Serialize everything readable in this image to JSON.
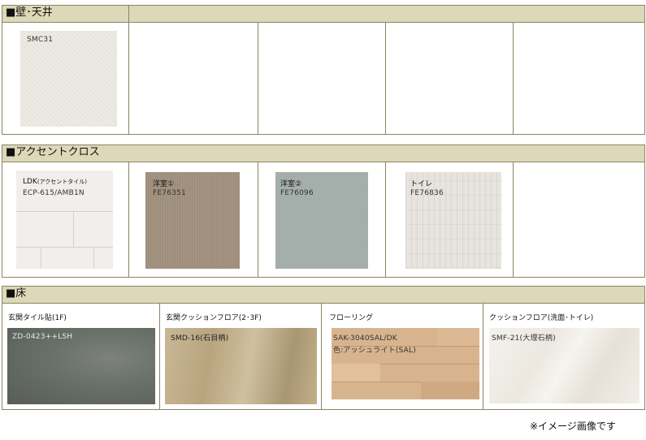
{
  "sections": {
    "wall": {
      "title": "■壁･天井",
      "items": [
        {
          "code": "SMC31"
        }
      ]
    },
    "accent": {
      "title": "■アクセントクロス",
      "items": [
        {
          "room": "LDK",
          "room_note": "(アクセントタイル)",
          "code": "ECP-615/AMB1N"
        },
        {
          "room": "洋室①",
          "code": "FE76351"
        },
        {
          "room": "洋室②",
          "code": "FE76096"
        },
        {
          "room": "トイレ",
          "code": "FE76836"
        }
      ]
    },
    "floor": {
      "title": "■床",
      "items": [
        {
          "label": "玄関タイル貼(1F)",
          "code": "ZD-0423++LSH"
        },
        {
          "label": "玄関クッションフロア(2･3F)",
          "code": "SMD-16(石目柄)"
        },
        {
          "label": "フローリング",
          "code": "SAK-3040SAL/DK",
          "code2": "色:アッシュライト(SAL)"
        },
        {
          "label": "クッションフロア(洗面･トイレ)",
          "code": "SMF-21(大理石柄)"
        }
      ]
    }
  },
  "note": "※イメージ画像です"
}
